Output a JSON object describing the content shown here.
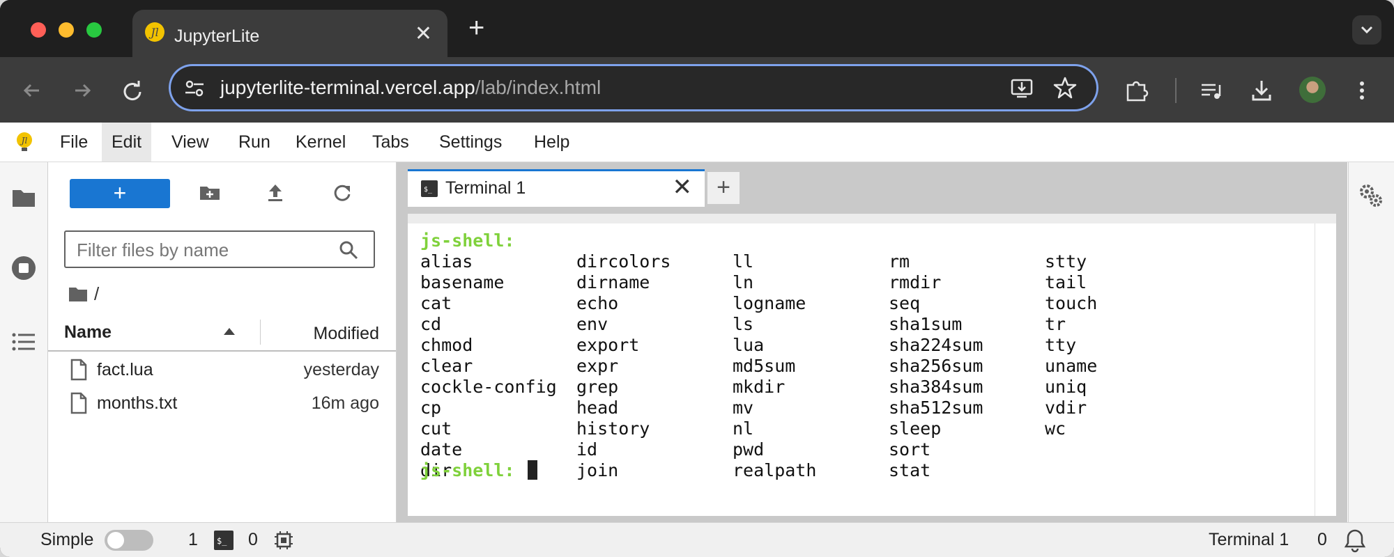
{
  "browser": {
    "tab_title": "JupyterLite",
    "url_host": "jupyterlite-terminal.vercel.app",
    "url_path": "/lab/index.html"
  },
  "menubar": [
    "File",
    "Edit",
    "View",
    "Run",
    "Kernel",
    "Tabs",
    "Settings",
    "Help"
  ],
  "file_browser": {
    "new_button": "+",
    "filter_placeholder": "Filter files by name",
    "breadcrumb": "/",
    "col_name": "Name",
    "col_modified": "Modified",
    "files": [
      {
        "name": "fact.lua",
        "modified": "yesterday"
      },
      {
        "name": "months.txt",
        "modified": "16m ago"
      }
    ]
  },
  "dock": {
    "tab_title": "Terminal 1",
    "add_tab": "+"
  },
  "terminal": {
    "prompt": "js-shell:",
    "columns": [
      [
        "alias",
        "basename",
        "cat",
        "cd",
        "chmod",
        "clear",
        "cockle-config",
        "cp",
        "cut",
        "date",
        "dir"
      ],
      [
        "dircolors",
        "dirname",
        "echo",
        "env",
        "export",
        "expr",
        "grep",
        "head",
        "history",
        "id",
        "join"
      ],
      [
        "ll",
        "ln",
        "logname",
        "ls",
        "lua",
        "md5sum",
        "mkdir",
        "mv",
        "nl",
        "pwd",
        "realpath"
      ],
      [
        "rm",
        "rmdir",
        "seq",
        "sha1sum",
        "sha224sum",
        "sha256sum",
        "sha384sum",
        "sha512sum",
        "sleep",
        "sort",
        "stat"
      ],
      [
        "stty",
        "tail",
        "touch",
        "tr",
        "tty",
        "uname",
        "uniq",
        "vdir",
        "wc"
      ]
    ]
  },
  "statusbar": {
    "mode_label": "Simple",
    "terminals_count": "1",
    "kernels_count": "0",
    "active_tab": "Terminal 1",
    "notifications_count": "0"
  },
  "colors": {
    "accent": "#1976d2",
    "prompt": "#7fd13b",
    "omnibox_focus": "#7ea2ec"
  }
}
